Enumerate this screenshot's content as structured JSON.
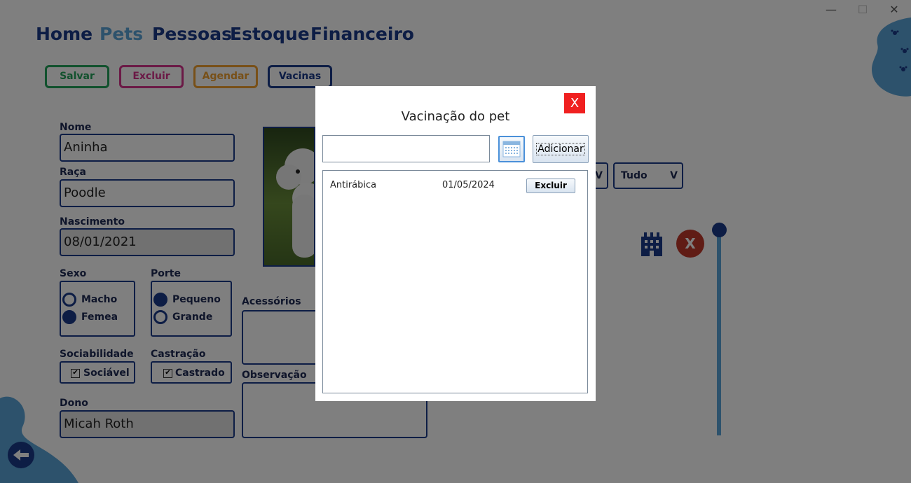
{
  "window": {
    "minimize": "—",
    "maximize": "☐",
    "close": "✕"
  },
  "nav": {
    "home": "Home",
    "pets": "Pets",
    "people": "Pessoas",
    "stock": "Estoque",
    "finance": "Financeiro"
  },
  "toolbar": {
    "save": "Salvar",
    "delete": "Excluir",
    "schedule": "Agendar",
    "vaccines": "Vacinas"
  },
  "form": {
    "name_label": "Nome",
    "name": "Aninha",
    "breed_label": "Raça",
    "breed": "Poodle",
    "birth_label": "Nascimento",
    "birth": "08/01/2021",
    "sex_label": "Sexo",
    "sex_options": [
      "Macho",
      "Femea"
    ],
    "sex_selected": "Femea",
    "size_label": "Porte",
    "size_options": [
      "Pequeno",
      "Grande"
    ],
    "size_selected": "Pequeno",
    "sociability_label": "Sociabilidade",
    "sociable": "Sociável",
    "castration_label": "Castração",
    "castrated": "Castrado",
    "owner_label": "Dono",
    "owner": "Micah Roth",
    "accessories_label": "Acessórios",
    "notes_label": "Observação"
  },
  "filters": {
    "combo1_arrow": "V",
    "combo2_value": "Tudo",
    "combo2_arrow": "V"
  },
  "actions": {
    "remove_label": "X"
  },
  "icons": {
    "building": "building-icon",
    "back": "arrow-left-icon",
    "paw": "paw-icon"
  },
  "colors": {
    "navy": "#1a3a8a",
    "green": "#22a35a",
    "pink": "#d6338c",
    "orange": "#f0a030",
    "sky": "#5aa5d8",
    "close_red": "#f02020",
    "remove_red": "#c0392b"
  },
  "dialog": {
    "title": "Vacinação do pet",
    "close": "X",
    "input_value": "",
    "add_button": "Adicionar",
    "vaccines": [
      {
        "name": "Antirábica",
        "date": "01/05/2024",
        "action": "Excluir"
      }
    ]
  }
}
